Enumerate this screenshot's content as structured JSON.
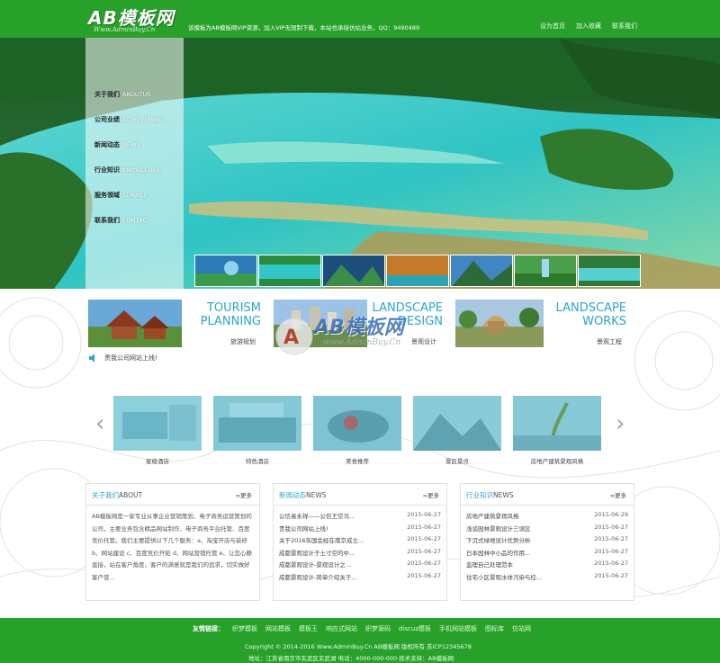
{
  "header": {
    "logo_text": "AB模板网",
    "logo_sub": "Www.AdminBuy.Cn",
    "notice": "该模板为AB模板网VIP资源，加入VIP无限制下载，本站也承接仿站业务，QQ：9490489",
    "links": [
      "设为首页",
      "加入收藏",
      "联系我们"
    ]
  },
  "nav": [
    {
      "zh": "关于我们",
      "en": "ABOUTUS"
    },
    {
      "zh": "公司业绩",
      "en": "ACHIEVEMENT"
    },
    {
      "zh": "新闻动态",
      "en": "NEWS"
    },
    {
      "zh": "行业知识",
      "en": "KNOWLEDGE"
    },
    {
      "zh": "服务领域",
      "en": "SERVICE"
    },
    {
      "zh": "联系我们",
      "en": "CONTACT"
    }
  ],
  "services": [
    {
      "title_line1": "TOURISM",
      "title_line2": "PLANNING",
      "sub": "旅游规划"
    },
    {
      "title_line1": "LANDSCAPE",
      "title_line2": "DESIGN",
      "sub": "景观设计"
    },
    {
      "title_line1": "LANDSCAPE",
      "title_line2": "WORKS",
      "sub": "景观工程"
    }
  ],
  "announcement": "贵我公司网站上线!",
  "watermark": {
    "text": "AB模板网",
    "sub": "www.AdminBuy.Cn"
  },
  "gallery": [
    "星级酒店",
    "特色酒店",
    "美食推荐",
    "景区景点",
    "房地产建筑景观风格"
  ],
  "about": {
    "title_zh": "关于我们",
    "title_en": "ABOUT",
    "more": "更多",
    "text": "AB模板网是一家专业从事企业营销策划、电子商务运营策划的公司，主要业务包含精品网站制作、电子商务平台托管、百度竞价托管。我们主要提供以下几个服务：a、淘宝开店与装修 b、网站建设 c、百度竞价开拓 d、网站营销托管 e、让您心静直接，站在客户角度，客户的满意就是我们的追求，切实做好客户营..."
  },
  "news": {
    "title_zh": "新闻动态",
    "title_en": "NEWS",
    "more": "更多",
    "items": [
      {
        "title": "公信者永祥——公信王空马...",
        "date": "2015-06-27"
      },
      {
        "title": "贵我公司网站上线!",
        "date": "2015-06-27"
      },
      {
        "title": "关于2016年国会经在南京成立...",
        "date": "2015-06-27"
      },
      {
        "title": "成都景观设计于土寸空的中...",
        "date": "2015-06-27"
      },
      {
        "title": "成都景观设计-景观设计之...",
        "date": "2015-06-27"
      },
      {
        "title": "成都景观设计-简单介绍关于...",
        "date": "2015-06-27"
      }
    ]
  },
  "knowledge": {
    "title_zh": "行业知识",
    "title_en": "NEWS",
    "more": "更多",
    "items": [
      {
        "title": "房地产建筑景观风格",
        "date": "2015-06-29"
      },
      {
        "title": "浅谈园林景观设计三误区",
        "date": "2015-06-27"
      },
      {
        "title": "下沉式绿地设计优势分析",
        "date": "2015-06-27"
      },
      {
        "title": "日本园林中小品的作用...",
        "date": "2015-06-27"
      },
      {
        "title": "监理自己处理范本",
        "date": "2015-06-27"
      },
      {
        "title": "住宅小区景观水体污染与控...",
        "date": "2015-06-27"
      }
    ]
  },
  "footer": {
    "links_label": "友情链接：",
    "links": [
      "织梦模板",
      "网站模板",
      "模板王",
      "响应式网站",
      "织梦源码",
      "discuz模板",
      "手机网站模板",
      "图标库",
      "仿站网"
    ],
    "copyright": "Copyright © 2014-2016 Www.AdminBuy.Cn AB模板网 版权所有 苏ICP12345678",
    "address": "地址：江苏省南京市玄武区玄武湖 电话：4000-000-000 技术支持：AB模板网"
  }
}
